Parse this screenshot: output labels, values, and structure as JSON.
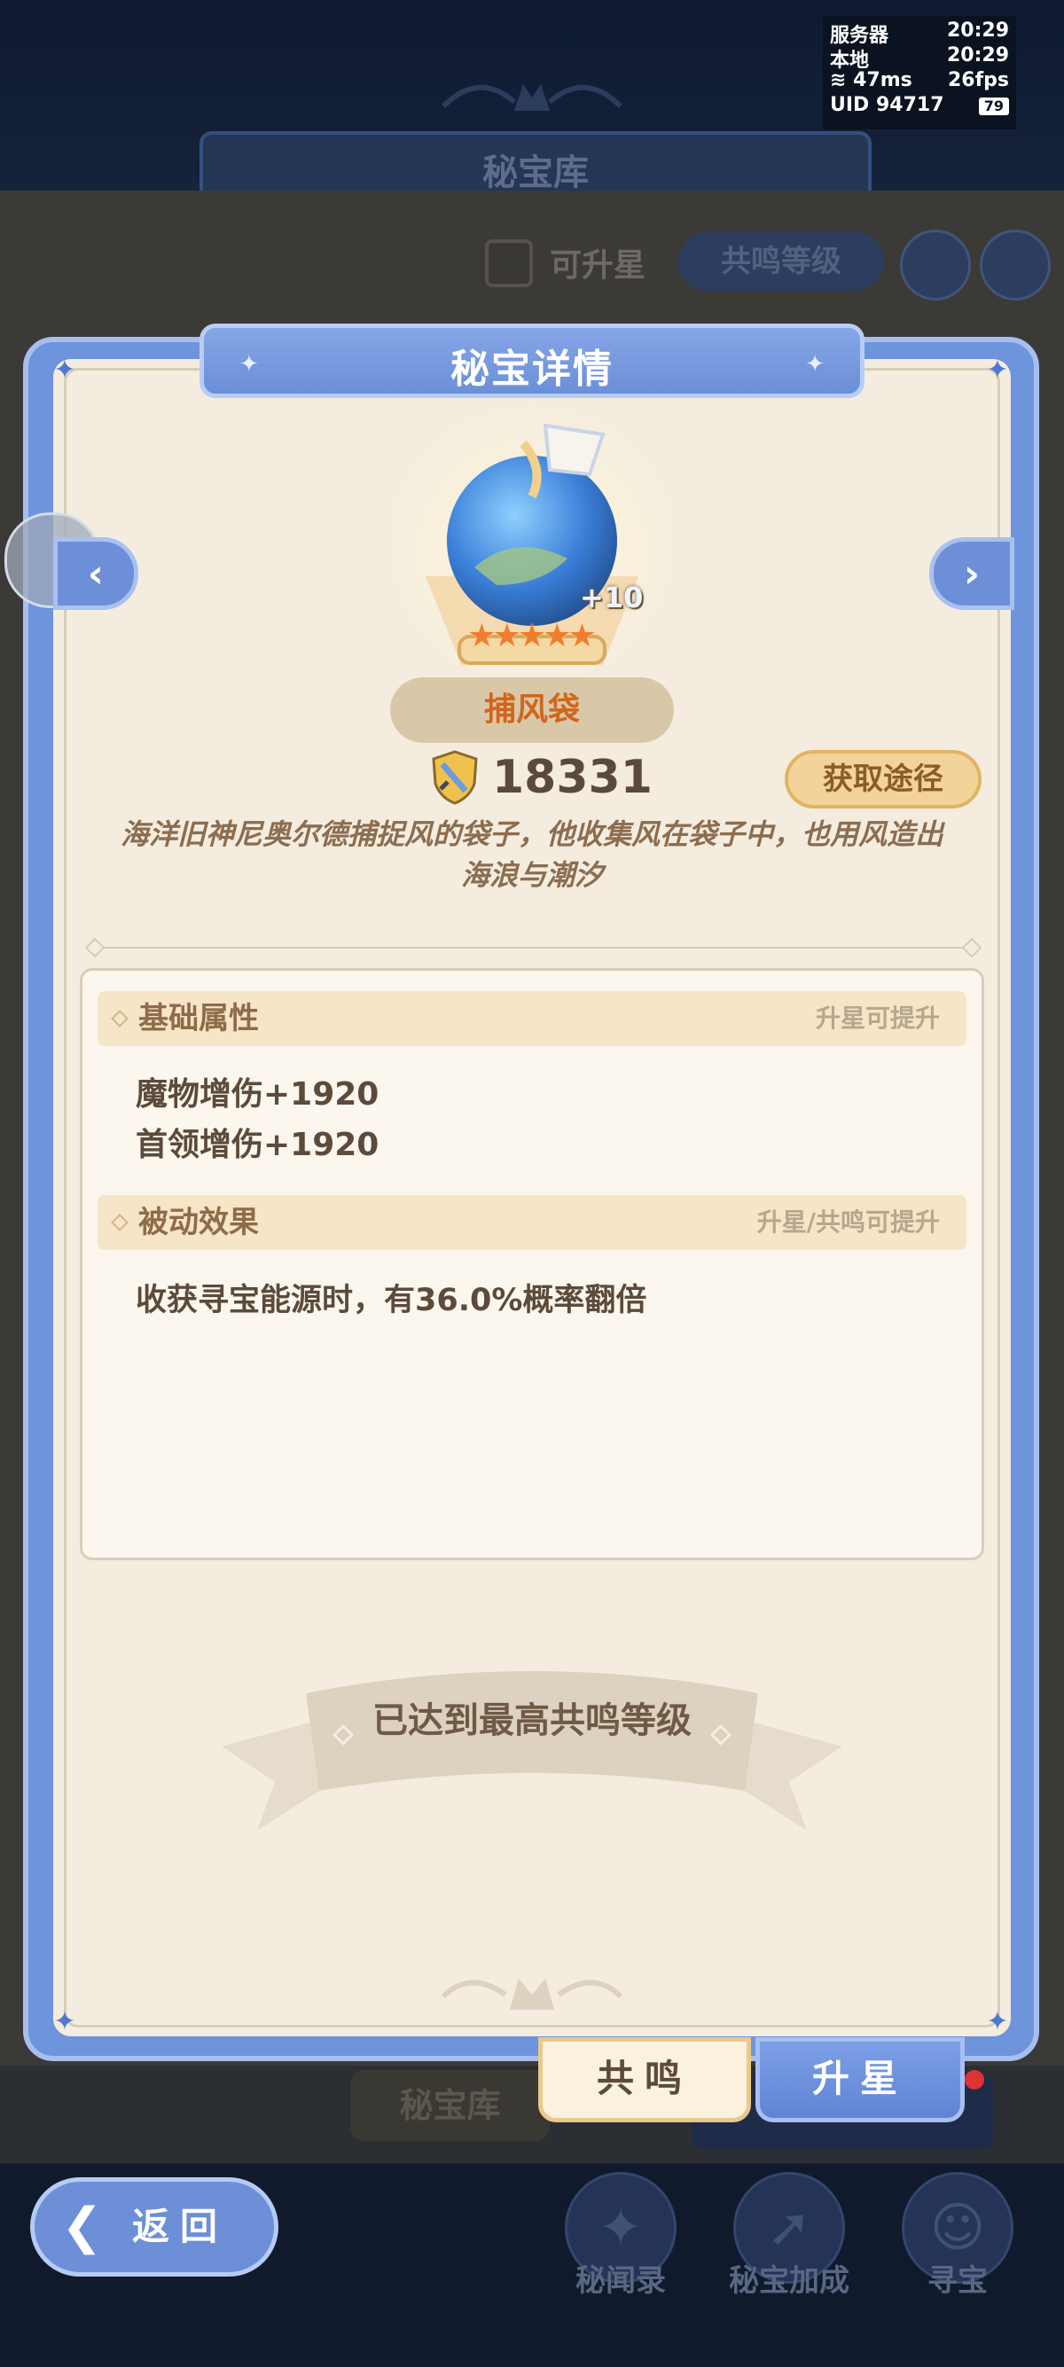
{
  "background": {
    "page_title": "秘宝库",
    "filter_checkbox_label": "可升星",
    "resonance_sort_label": "共鸣等级",
    "tab_label": "秘宝库",
    "nav": [
      {
        "label": "秘闻录",
        "icon": "book-icon"
      },
      {
        "label": "秘宝加成",
        "icon": "arrow-up-icon"
      },
      {
        "label": "寻宝",
        "icon": "treasure-hunt-icon"
      }
    ]
  },
  "hud": {
    "server_label": "服务器",
    "server_time": "20:29",
    "local_label": "本地",
    "local_time": "20:29",
    "ping": "47ms",
    "fps": "26fps",
    "uid_label": "UID",
    "uid": "94717",
    "battery": "79"
  },
  "dialog": {
    "title": "秘宝详情",
    "item": {
      "name": "捕风袋",
      "level": "+10",
      "stars": 5,
      "power": "18331",
      "description": "海洋旧神尼奥尔德捕捉风的袋子，他收集风在袋子中，也用风造出海浪与潮汐"
    },
    "source_button": "获取途径",
    "base_section": {
      "title": "基础属性",
      "hint": "升星可提升",
      "lines": [
        "魔物增伤+1920",
        "首领增伤+1920"
      ]
    },
    "passive_section": {
      "title": "被动效果",
      "hint": "升星/共鸣可提升",
      "lines": [
        "收获寻宝能源时，有36.0%概率翻倍"
      ]
    },
    "max_banner": "已达到最高共鸣等级",
    "tab_resonance": "共鸣",
    "tab_star": "升星"
  },
  "back_button": "返回",
  "colors": {
    "accent_blue": "#6e94dc",
    "panel_bg": "#f4eddf",
    "item_name": "#d1651c",
    "star": "#ef7d2f"
  }
}
